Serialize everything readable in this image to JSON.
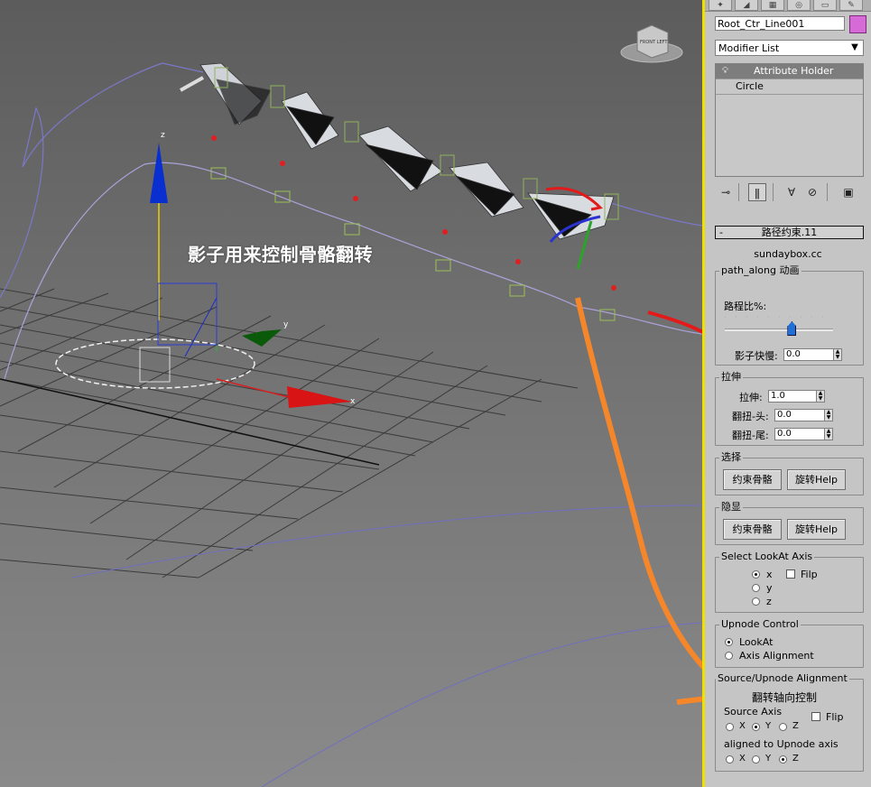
{
  "viewport": {
    "caption": "影子用来控制骨骼翻转",
    "viewcube_label": "FRONT LEFT",
    "axis_labels": {
      "x": "x",
      "y": "y",
      "z": "z"
    }
  },
  "panel": {
    "tabs": [
      "create-icon",
      "modify-icon",
      "hierarchy-icon",
      "motion-icon",
      "display-icon",
      "utilities-icon"
    ],
    "object_name": "Root_Ctr_Line001",
    "object_color": "#d66ad6",
    "modifier_list_label": "Modifier List",
    "modifier_stack": [
      {
        "label": "Attribute Holder",
        "selected": true
      },
      {
        "label": "Circle",
        "selected": false
      }
    ],
    "rollout": {
      "title": "路径约束.11",
      "collapse_symbol": "-",
      "domain": "sundaybox.cc",
      "path_along": {
        "title": "path_along 动画",
        "ratio_label": "路程比%:",
        "ratio_value": 0.62,
        "shadow_speed_label": "影子快慢:",
        "shadow_speed_value": "0.0"
      },
      "stretch": {
        "title": "拉伸",
        "stretch_label": "拉伸:",
        "stretch_value": "1.0",
        "twist_head_label": "翻扭-头:",
        "twist_head_value": "0.0",
        "twist_tail_label": "翻扭-尾:",
        "twist_tail_value": "0.0"
      },
      "select": {
        "title": "选择",
        "btn_constrain": "约束骨骼",
        "btn_rotate": "旋转Help"
      },
      "hide_show": {
        "title": "隐显",
        "btn_constrain": "约束骨骼",
        "btn_rotate": "旋转Help"
      },
      "lookat_axis": {
        "title": "Select LookAt Axis",
        "options": [
          "x",
          "y",
          "z"
        ],
        "selected": "x",
        "flip_label": "Filp"
      },
      "upnode_control": {
        "title": "Upnode Control",
        "options": [
          "LookAt",
          "Axis Alignment"
        ],
        "selected": "LookAt"
      },
      "alignment": {
        "title": "Source/Upnode Alignment",
        "subtitle": "翻转轴向控制",
        "source_axis_label": "Source Axis",
        "flip_label": "Flip",
        "source_options": [
          "X",
          "Y",
          "Z"
        ],
        "source_selected": "Y",
        "upnode_label": "aligned to Upnode axis",
        "upnode_options": [
          "X",
          "Y",
          "Z"
        ],
        "upnode_selected": "Z"
      }
    }
  }
}
